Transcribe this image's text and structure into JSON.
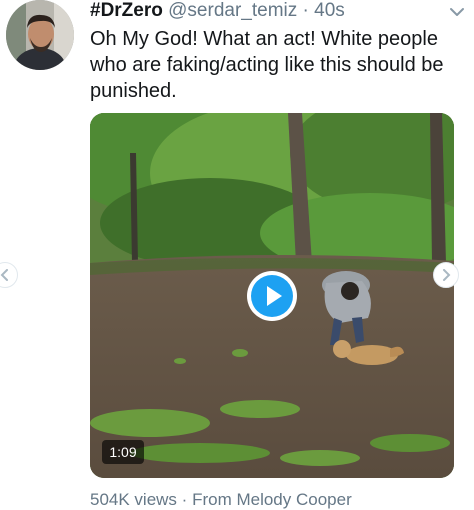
{
  "tweet": {
    "display_name": "#DrZero",
    "handle": "@serdar_temiz",
    "separator": "·",
    "time": "40s",
    "text": "Oh My God! What an act! White people who are faking/acting like this should be punished.",
    "video": {
      "duration": "1:09",
      "play_icon": "play-icon"
    },
    "views": "504K views",
    "footer_separator": "·",
    "source": "From Melody Cooper"
  },
  "colors": {
    "text": "#14171a",
    "secondary": "#657786",
    "accent": "#1da1f2"
  }
}
